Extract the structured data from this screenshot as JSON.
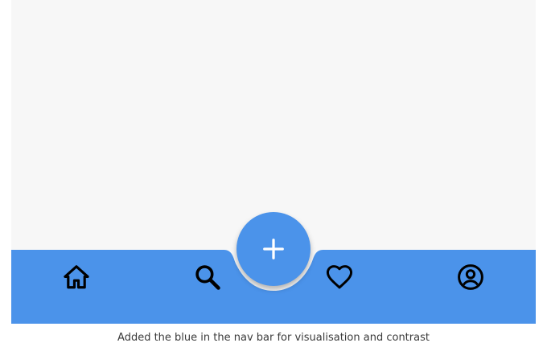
{
  "app": {
    "accent_color": "#4b93ea",
    "icon_color": "#000000",
    "background_color": "#f7f7f7"
  },
  "bottom_nav": {
    "items": [
      {
        "icon": "home-icon"
      },
      {
        "icon": "search-icon"
      },
      {
        "icon": "heart-icon"
      },
      {
        "icon": "account-circle-icon"
      }
    ]
  },
  "fab": {
    "icon": "plus-icon",
    "icon_color": "#ffffff"
  },
  "caption": {
    "text": "Added the blue in the nav bar for visualisation and contrast"
  }
}
